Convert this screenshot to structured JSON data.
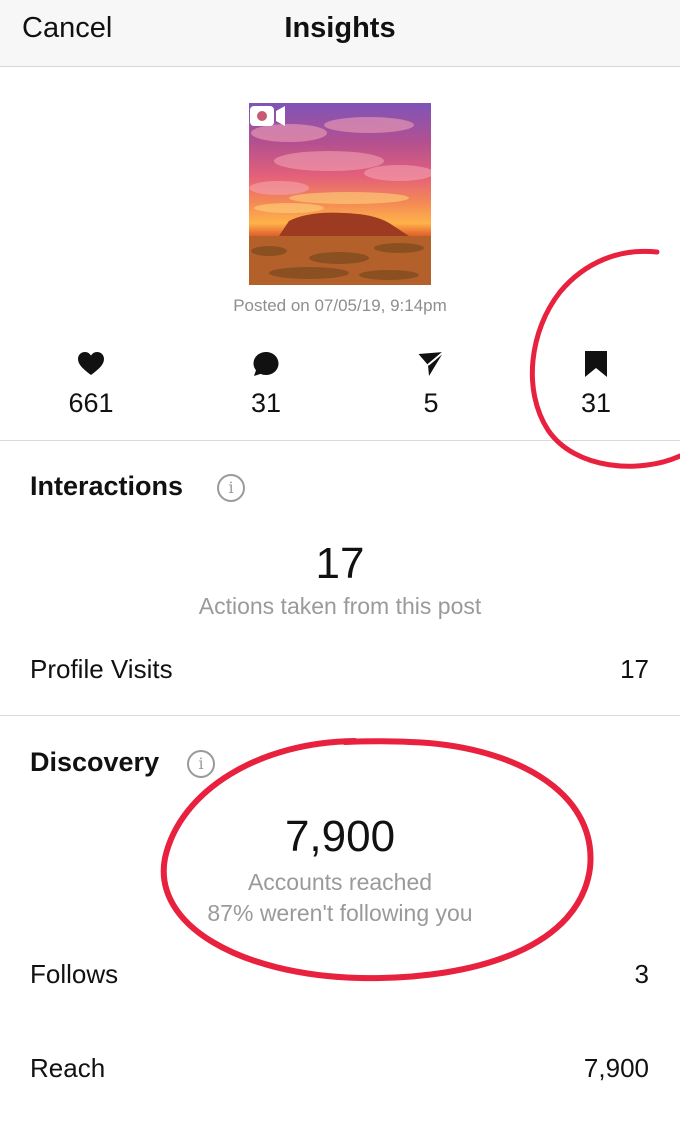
{
  "header": {
    "cancel_label": "Cancel",
    "title": "Insights"
  },
  "post": {
    "posted_on": "Posted on 07/05/19, 9:14pm",
    "media_type_icon": "video-icon"
  },
  "stats": [
    {
      "icon": "heart-icon",
      "value": "661"
    },
    {
      "icon": "comment-icon",
      "value": "31"
    },
    {
      "icon": "send-icon",
      "value": "5"
    },
    {
      "icon": "bookmark-icon",
      "value": "31"
    }
  ],
  "interactions": {
    "title": "Interactions",
    "total": "17",
    "caption": "Actions taken from this post",
    "rows": [
      {
        "label": "Profile Visits",
        "value": "17"
      }
    ]
  },
  "discovery": {
    "title": "Discovery",
    "total": "7,900",
    "caption_line1": "Accounts reached",
    "caption_line2": "87% weren't following you",
    "rows": [
      {
        "label": "Follows",
        "value": "3"
      },
      {
        "label": "Reach",
        "value": "7,900"
      }
    ]
  },
  "colors": {
    "annotation": "#e8213e",
    "muted_text": "#8e8e8e",
    "accent": "#111111"
  }
}
